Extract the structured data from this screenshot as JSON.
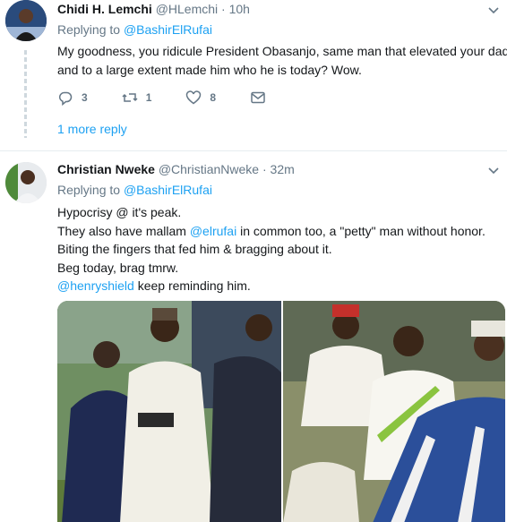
{
  "tweets": [
    {
      "name": "Chidi H. Lemchi",
      "handle": "@HLemchi",
      "sep": "·",
      "time": "10h",
      "replying_prefix": "Replying to",
      "replying_to": "@BashirElRufai",
      "lines": [
        "My goodness, you ridicule President Obasanjo, same man that elevated your dad",
        "and to a large extent made him who he is today? Wow."
      ],
      "actions": {
        "replies": "3",
        "retweets": "1",
        "likes": "8"
      },
      "more_reply": "1 more reply"
    },
    {
      "name": "Christian Nweke",
      "handle": "@ChristianNweke",
      "sep": "·",
      "time": "32m",
      "replying_prefix": "Replying to",
      "replying_to": "@BashirElRufai",
      "lines": {
        "l1": "Hypocrisy @ it's peak.",
        "l2_a": "They also have mallam ",
        "l2_mention": "@elrufai",
        "l2_b": " in common too, a \"petty\" man without honor.",
        "l3": "Biting the fingers that fed him & bragging about it.",
        "l4": "Beg today, brag tmrw.",
        "l5_mention": "@henryshield",
        "l5_b": " keep reminding him."
      }
    }
  ],
  "colors": {
    "link": "#1da1f2",
    "muted": "#657786",
    "text": "#14171a"
  },
  "icons": [
    "chevron-down-icon",
    "reply-icon",
    "retweet-icon",
    "like-icon",
    "message-icon"
  ]
}
